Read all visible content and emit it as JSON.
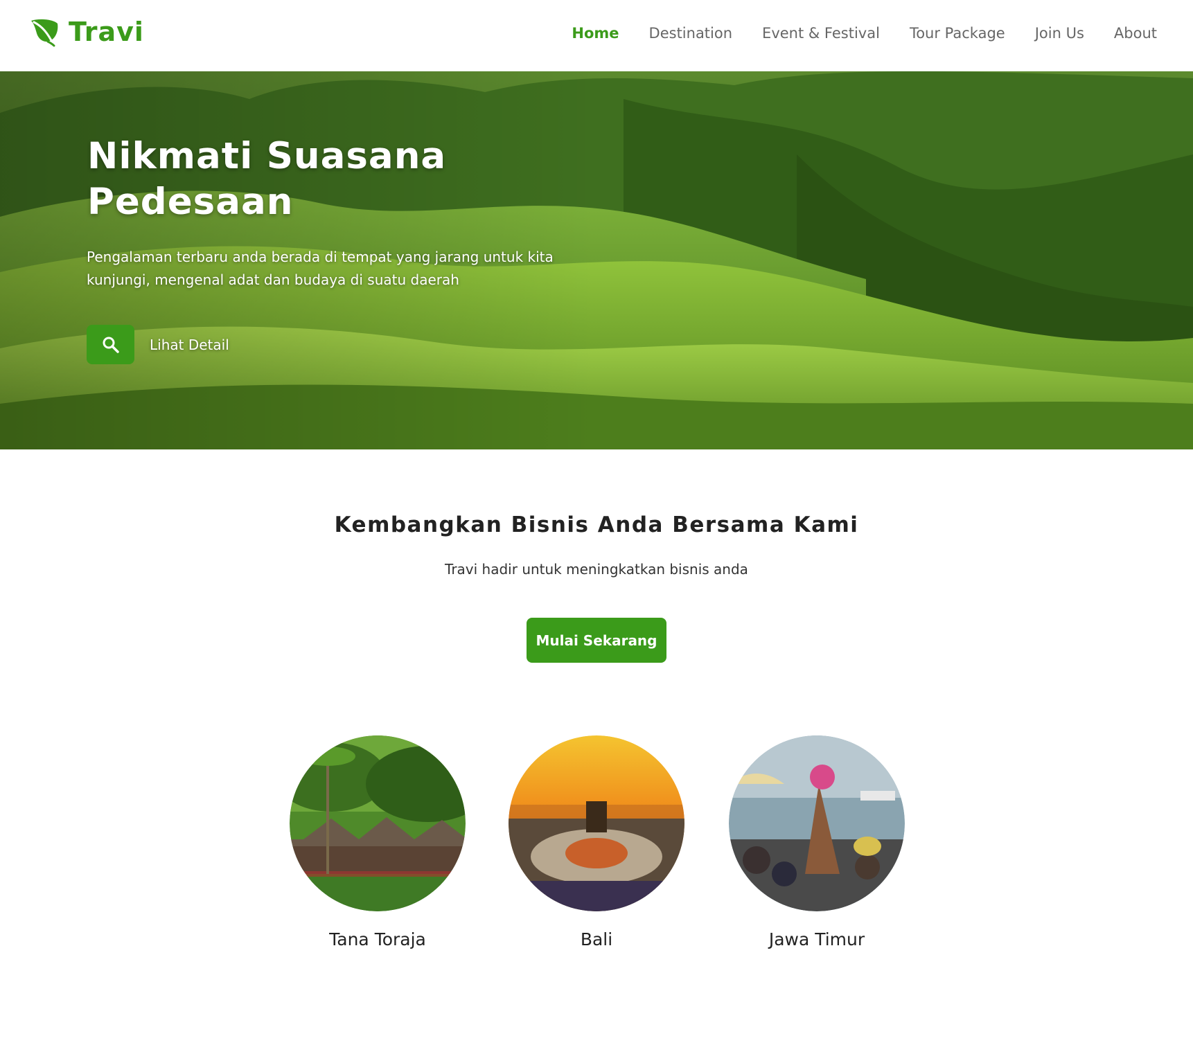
{
  "brand": {
    "name": "Travi",
    "color": "#3b9b1a"
  },
  "nav": {
    "items": [
      {
        "label": "Home",
        "active": true
      },
      {
        "label": "Destination",
        "active": false
      },
      {
        "label": "Event & Festival",
        "active": false
      },
      {
        "label": "Tour Package",
        "active": false
      },
      {
        "label": "Join Us",
        "active": false
      },
      {
        "label": "About",
        "active": false
      }
    ]
  },
  "hero": {
    "title": "Nikmati Suasana Pedesaan",
    "description": "Pengalaman terbaru anda berada di tempat yang jarang untuk kita kunjungi, mengenal adat dan budaya di suatu daerah",
    "cta_label": "Lihat Detail",
    "cta_icon": "search-icon"
  },
  "section": {
    "title": "Kembangkan Bisnis Anda Bersama Kami",
    "subtitle": "Travi hadir untuk meningkatkan bisnis anda",
    "button_label": "Mulai Sekarang"
  },
  "destinations": [
    {
      "name": "Tana Toraja"
    },
    {
      "name": "Bali"
    },
    {
      "name": "Jawa Timur"
    }
  ]
}
